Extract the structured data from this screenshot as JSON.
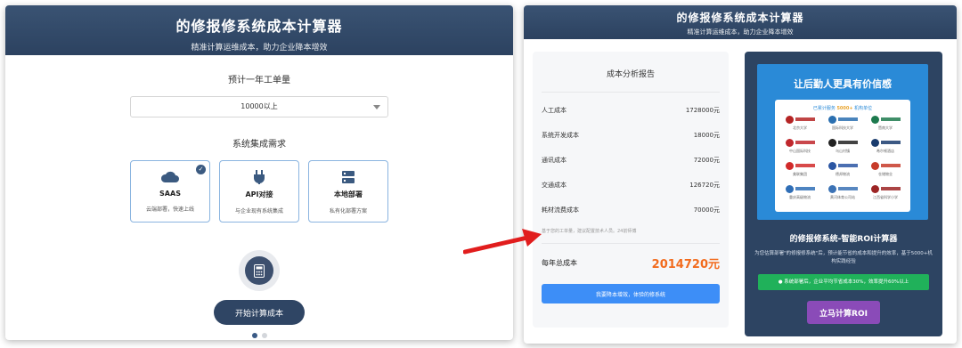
{
  "left": {
    "title": "的修报修系统成本计算器",
    "subtitle": "精准计算运维成本，助力企业降本增效",
    "q1_label": "预计一年工单量",
    "q1_value": "10000以上",
    "q2_label": "系统集成需求",
    "cards": [
      {
        "name": "SAAS",
        "desc": "云端部署，快速上线",
        "icon": "cloud-icon",
        "selected": true
      },
      {
        "name": "API对接",
        "desc": "与企业现有系统集成",
        "icon": "plug-icon",
        "selected": false
      },
      {
        "name": "本地部署",
        "desc": "私有化部署方案",
        "icon": "server-icon",
        "selected": false
      }
    ],
    "start_button": "开始计算成本",
    "pagination": {
      "count": 2,
      "active": 1
    }
  },
  "right": {
    "title": "的修报修系统成本计算器",
    "subtitle": "精准计算运维成本，助力企业降本增效",
    "report": {
      "title": "成本分析报告",
      "rows": [
        {
          "label": "人工成本",
          "value": "1728000元"
        },
        {
          "label": "系统开发成本",
          "value": "18000元"
        },
        {
          "label": "通讯成本",
          "value": "72000元"
        },
        {
          "label": "交通成本",
          "value": "126720元"
        },
        {
          "label": "耗材流费成本",
          "value": "70000元"
        }
      ],
      "note": "基于您的工单量，建议配置技术人员。24前师傅",
      "total_label": "每年总成本",
      "total_value": "2014720元",
      "cta": "我要降本增效，体验的修系统"
    },
    "roi": {
      "banner_title": "让后勤人更具有价信感",
      "served_prefix": "已累计服务",
      "served_count": "5000+",
      "served_suffix": "机构单位",
      "logos": [
        {
          "caption": "北京大学",
          "color": "#b52424"
        },
        {
          "caption": "国际科技大学",
          "color": "#2a6fb0"
        },
        {
          "caption": "暨南大学",
          "color": "#1d7a4e"
        },
        {
          "caption": "中山国际科技",
          "color": "#c0272d"
        },
        {
          "caption": "乌山村镇",
          "color": "#222222"
        },
        {
          "caption": "希尔顿酒店",
          "color": "#1a3c6e"
        },
        {
          "caption": "美联集团",
          "color": "#d12a2a"
        },
        {
          "caption": "德邦物流",
          "color": "#2b56a3"
        },
        {
          "caption": "仓储物业",
          "color": "#c73b2a"
        },
        {
          "caption": "重庆高级物流",
          "color": "#2f6eb6"
        },
        {
          "caption": "黄河体育公司站",
          "color": "#3b72b5"
        },
        {
          "caption": "江西省科学小学",
          "color": "#9c2525"
        }
      ],
      "title": "的修报修系统-智能ROI计算器",
      "desc": "为您估算部署\"的修报修系统\"后，预计能节省的成本和提升的效率，基于5000+机构实践经验",
      "green_text": "系统部署后，企业平均节省成本30%，效率提升60%以上",
      "button": "立马计算ROI"
    }
  },
  "colors": {
    "header": "#2c4260",
    "accent_blue": "#3d8ef7",
    "total_orange": "#f26b1d",
    "green": "#20b15a",
    "purple": "#8a4bb8",
    "arrow": "#e11d1d"
  }
}
